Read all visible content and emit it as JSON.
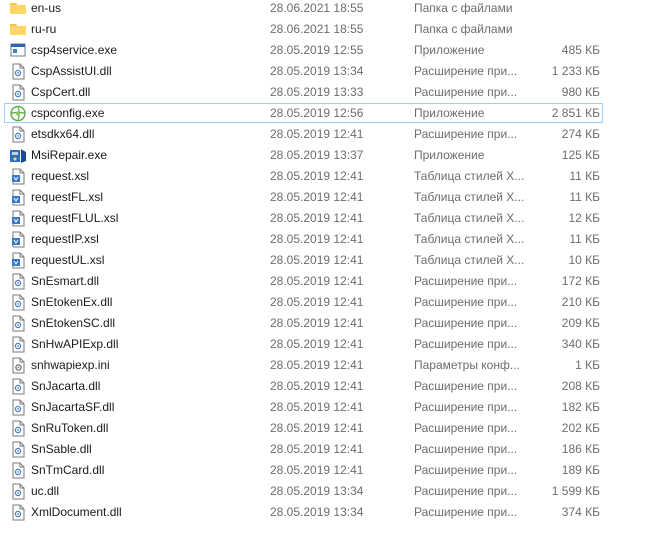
{
  "files": [
    {
      "name": "en-us",
      "date": "28.06.2021 18:55",
      "type": "Папка с файлами",
      "size": "",
      "icon": "folder-icon"
    },
    {
      "name": "ru-ru",
      "date": "28.06.2021 18:55",
      "type": "Папка с файлами",
      "size": "",
      "icon": "folder-icon"
    },
    {
      "name": "csp4service.exe",
      "date": "28.05.2019 12:55",
      "type": "Приложение",
      "size": "485 КБ",
      "icon": "application-icon"
    },
    {
      "name": "CspAssistUI.dll",
      "date": "28.05.2019 13:34",
      "type": "Расширение при...",
      "size": "1 233 КБ",
      "icon": "dll-file-icon"
    },
    {
      "name": "CspCert.dll",
      "date": "28.05.2019 13:33",
      "type": "Расширение при...",
      "size": "980 КБ",
      "icon": "dll-file-icon"
    },
    {
      "name": "cspconfig.exe",
      "date": "28.05.2019 12:56",
      "type": "Приложение",
      "size": "2 851 КБ",
      "icon": "cspconfig-app-icon"
    },
    {
      "name": "etsdkx64.dll",
      "date": "28.05.2019 12:41",
      "type": "Расширение при...",
      "size": "274 КБ",
      "icon": "dll-file-icon"
    },
    {
      "name": "MsiRepair.exe",
      "date": "28.05.2019 13:37",
      "type": "Приложение",
      "size": "125 КБ",
      "icon": "installer-app-icon"
    },
    {
      "name": "request.xsl",
      "date": "28.05.2019 12:41",
      "type": "Таблица стилей Х...",
      "size": "11 КБ",
      "icon": "xsl-file-icon"
    },
    {
      "name": "requestFL.xsl",
      "date": "28.05.2019 12:41",
      "type": "Таблица стилей Х...",
      "size": "11 КБ",
      "icon": "xsl-file-icon"
    },
    {
      "name": "requestFLUL.xsl",
      "date": "28.05.2019 12:41",
      "type": "Таблица стилей Х...",
      "size": "12 КБ",
      "icon": "xsl-file-icon"
    },
    {
      "name": "requestIP.xsl",
      "date": "28.05.2019 12:41",
      "type": "Таблица стилей Х...",
      "size": "11 КБ",
      "icon": "xsl-file-icon"
    },
    {
      "name": "requestUL.xsl",
      "date": "28.05.2019 12:41",
      "type": "Таблица стилей Х...",
      "size": "10 КБ",
      "icon": "xsl-file-icon"
    },
    {
      "name": "SnEsmart.dll",
      "date": "28.05.2019 12:41",
      "type": "Расширение при...",
      "size": "172 КБ",
      "icon": "dll-file-icon"
    },
    {
      "name": "SnEtokenEx.dll",
      "date": "28.05.2019 12:41",
      "type": "Расширение при...",
      "size": "210 КБ",
      "icon": "dll-file-icon"
    },
    {
      "name": "SnEtokenSC.dll",
      "date": "28.05.2019 12:41",
      "type": "Расширение при...",
      "size": "209 КБ",
      "icon": "dll-file-icon"
    },
    {
      "name": "SnHwAPIExp.dll",
      "date": "28.05.2019 12:41",
      "type": "Расширение при...",
      "size": "340 КБ",
      "icon": "dll-file-icon"
    },
    {
      "name": "snhwapiexp.ini",
      "date": "28.05.2019 12:41",
      "type": "Параметры конф...",
      "size": "1 КБ",
      "icon": "ini-file-icon"
    },
    {
      "name": "SnJacarta.dll",
      "date": "28.05.2019 12:41",
      "type": "Расширение при...",
      "size": "208 КБ",
      "icon": "dll-file-icon"
    },
    {
      "name": "SnJacartaSF.dll",
      "date": "28.05.2019 12:41",
      "type": "Расширение при...",
      "size": "182 КБ",
      "icon": "dll-file-icon"
    },
    {
      "name": "SnRuToken.dll",
      "date": "28.05.2019 12:41",
      "type": "Расширение при...",
      "size": "202 КБ",
      "icon": "dll-file-icon"
    },
    {
      "name": "SnSable.dll",
      "date": "28.05.2019 12:41",
      "type": "Расширение при...",
      "size": "186 КБ",
      "icon": "dll-file-icon"
    },
    {
      "name": "SnTmCard.dll",
      "date": "28.05.2019 12:41",
      "type": "Расширение при...",
      "size": "189 КБ",
      "icon": "dll-file-icon"
    },
    {
      "name": "uc.dll",
      "date": "28.05.2019 13:34",
      "type": "Расширение при...",
      "size": "1 599 КБ",
      "icon": "dll-file-icon"
    },
    {
      "name": "XmlDocument.dll",
      "date": "28.05.2019 13:34",
      "type": "Расширение при...",
      "size": "374 КБ",
      "icon": "dll-file-icon"
    }
  ],
  "selected_file": "cspconfig.exe",
  "colors": {
    "text_primary": "#1a1a1a",
    "text_secondary": "#6d6d6d",
    "selection_border": "#99d1ff",
    "folder": "#f5c542"
  }
}
